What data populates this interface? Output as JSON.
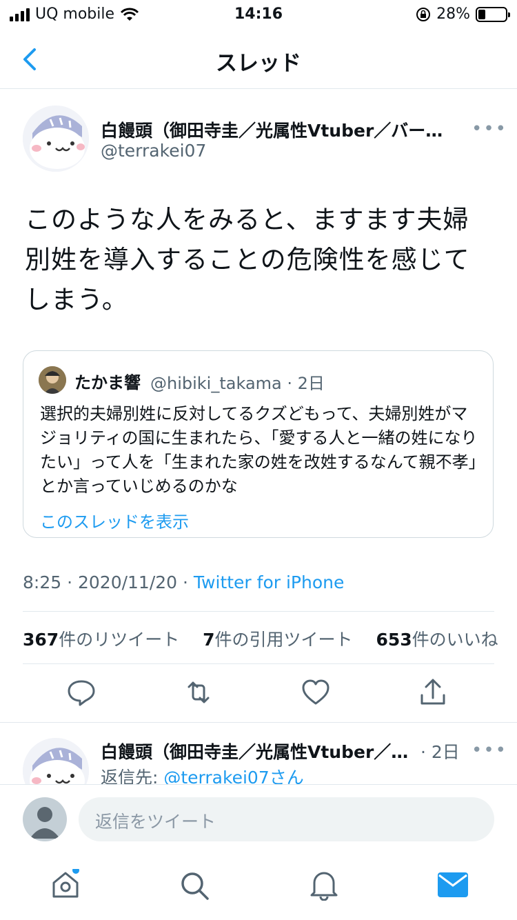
{
  "status": {
    "carrier": "UQ mobile",
    "time": "14:16",
    "battery": "28%"
  },
  "nav": {
    "title": "スレッド"
  },
  "tweet": {
    "name": "白饅頭（御田寺圭／光属性Vtuber／バー…",
    "handle": "@terrakei07",
    "more": "•••",
    "text": "このような人をみると、ますます夫婦別姓を導入することの危険性を感じてしまう。",
    "quote": {
      "name": "たかま響",
      "handle": "@hibiki_takama · 2日",
      "text": "選択的夫婦別姓に反対してるクズどもって、夫婦別姓がマジョリティの国に生まれたら、「愛する人と一緒の姓になりたい」って人を「生まれた家の姓を改姓するなんて親不孝」とか言っていじめるのかな",
      "show_thread": "このスレッドを表示"
    },
    "meta": {
      "time": "8:25 · 2020/11/20 · ",
      "source": "Twitter for iPhone"
    },
    "stats": {
      "retweets_count": "367",
      "retweets_label": "件のリツイート",
      "quotes_count": "7",
      "quotes_label": "件の引用ツイート",
      "likes_count": "653",
      "likes_label": "件のいいね"
    }
  },
  "reply": {
    "name": "白饅頭（御田寺圭／光属性Vtuber／…",
    "time": "· 2日",
    "more": "•••",
    "reply_to_prefix": "返信先: ",
    "reply_to": "@terrakei07さん"
  },
  "composer": {
    "placeholder": "返信をツイート"
  },
  "colors": {
    "accent": "#1d9bf0",
    "text": "#0f1419",
    "muted": "#536471",
    "border": "#e1e8ed"
  }
}
